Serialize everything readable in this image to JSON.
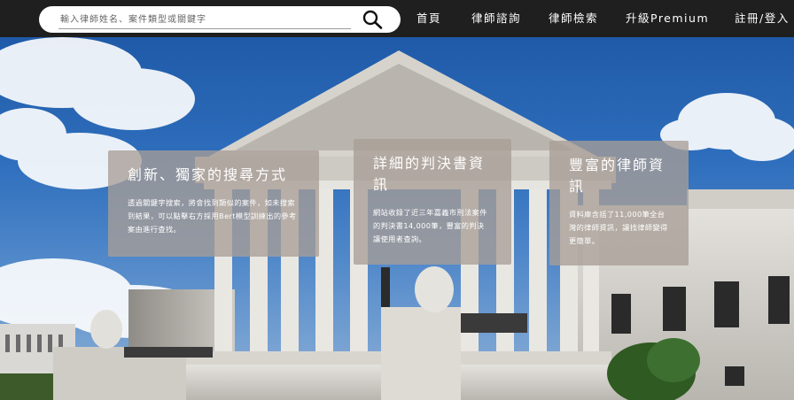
{
  "search": {
    "placeholder": "輸入律師姓名、案件類型或關鍵字",
    "icon": "search-icon"
  },
  "nav": {
    "home": "首頁",
    "consult": "律師諮詢",
    "lawyer_search": "律師檢索",
    "upgrade": "升級Premium",
    "register_login": "註冊/登入"
  },
  "features": [
    {
      "title": "創新、獨家的搜尋方式",
      "desc": "透過關鍵字搜索，將會找到類似的案件，如未搜索到結果，可以點擊右方採用Bert模型訓練出的參考案由進行查找。"
    },
    {
      "title": "詳細的判決書資訊",
      "desc": "網站收錄了近三年嘉義市刑法案件的判決書14,000筆，豐富的判決讓使用者查詢。"
    },
    {
      "title": "豐富的律師資訊",
      "desc": "資料庫含括了11,000筆全台灣的律師資訊，讓找律師變得更簡單。"
    }
  ],
  "colors": {
    "navbar": "#1f1f1f",
    "sky": "#2f6fbd",
    "card": "#a89e96"
  }
}
